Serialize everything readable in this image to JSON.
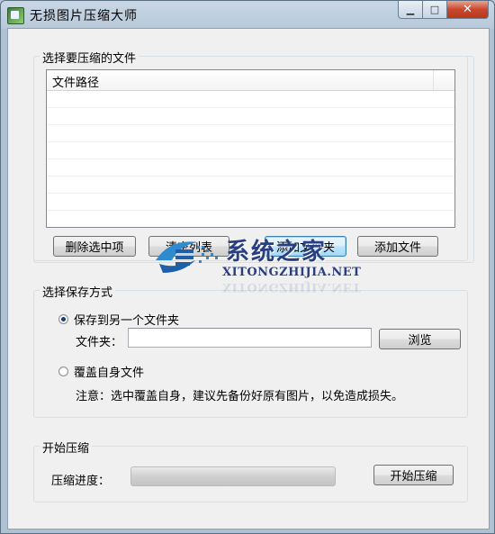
{
  "window": {
    "title": "无损图片压缩大师",
    "minimize_glyph": "▁",
    "maximize_glyph": "□",
    "close_glyph": "✕"
  },
  "file_group": {
    "label": "选择要压缩的文件",
    "column_header": "文件路径",
    "rows": [
      "",
      "",
      "",
      "",
      "",
      "",
      "",
      ""
    ],
    "buttons": {
      "delete_selected": "删除选中项",
      "clear_list": "清空列表",
      "add_folder": "添加文件夹",
      "add_file": "添加文件"
    }
  },
  "save_group": {
    "label": "选择保存方式",
    "option_other_folder": "保存到另一个文件夹",
    "option_other_folder_checked": true,
    "folder_label": "文件夹：",
    "folder_value": "",
    "browse_button": "浏览",
    "option_overwrite": "覆盖自身文件",
    "option_overwrite_checked": false,
    "note": "注意：选中覆盖自身，建议先备份好原有图片，以免造成损失。"
  },
  "compress_group": {
    "label": "开始压缩",
    "progress_label": "压缩进度：",
    "progress_percent": 0,
    "start_button": "开始压缩"
  },
  "watermark": {
    "title": "系统之家",
    "subtitle": "XITONGZHIJIA.NET"
  }
}
